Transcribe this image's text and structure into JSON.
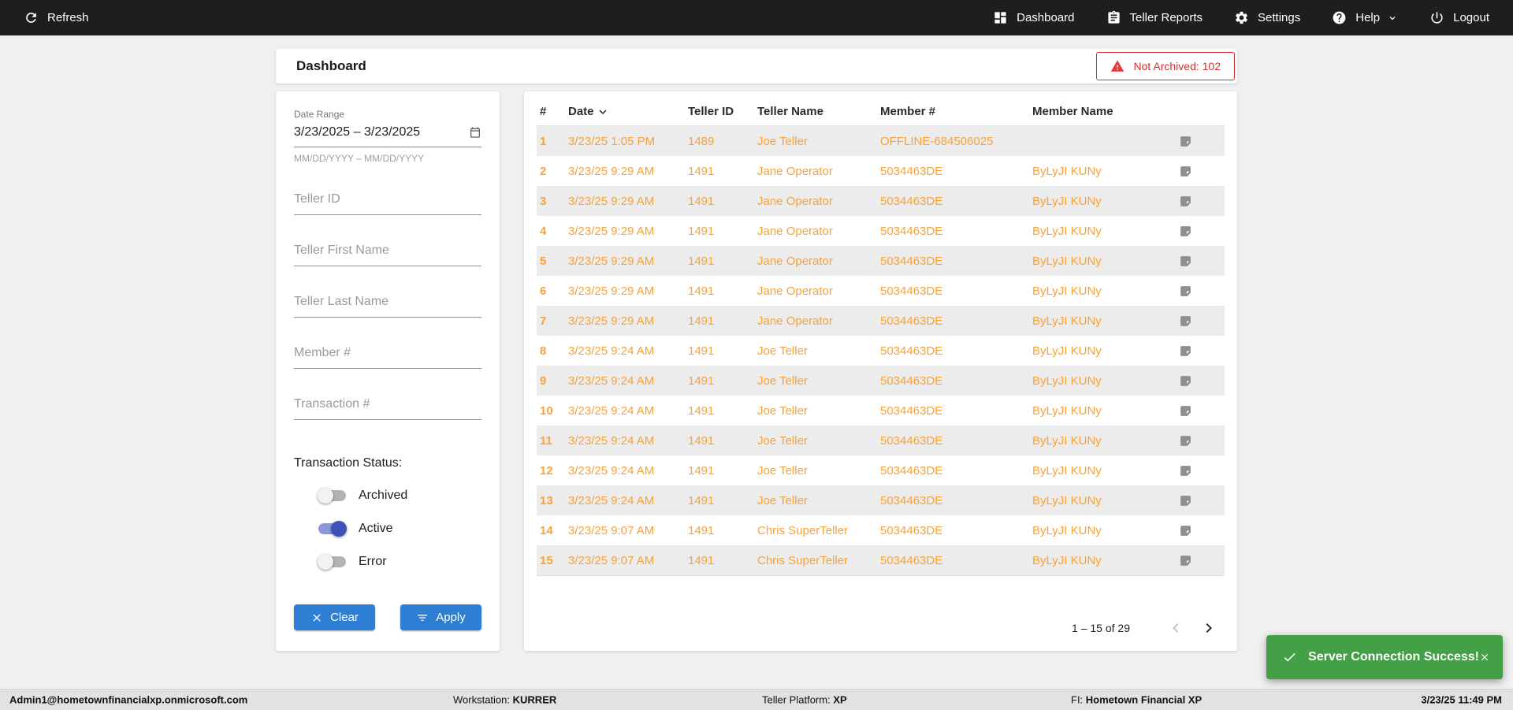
{
  "topbar": {
    "refresh": "Refresh",
    "dashboard": "Dashboard",
    "teller_reports": "Teller Reports",
    "settings": "Settings",
    "help": "Help",
    "logout": "Logout"
  },
  "header": {
    "title": "Dashboard",
    "not_archived_badge": "Not Archived: 102"
  },
  "filters": {
    "date_range_label": "Date Range",
    "date_range_value": "3/23/2025 – 3/23/2025",
    "date_range_hint": "MM/DD/YYYY – MM/DD/YYYY",
    "teller_id_placeholder": "Teller ID",
    "teller_first_name_placeholder": "Teller First Name",
    "teller_last_name_placeholder": "Teller Last Name",
    "member_number_placeholder": "Member #",
    "transaction_number_placeholder": "Transaction #",
    "transaction_status_label": "Transaction Status:",
    "toggles": [
      {
        "label": "Archived",
        "on": false
      },
      {
        "label": "Active",
        "on": true
      },
      {
        "label": "Error",
        "on": false
      }
    ],
    "clear_button": "Clear",
    "apply_button": "Apply"
  },
  "table": {
    "columns": [
      "#",
      "Date",
      "Teller ID",
      "Teller Name",
      "Member #",
      "Member Name"
    ],
    "sort": {
      "column": "Date",
      "direction": "desc"
    },
    "rows": [
      {
        "num": "1",
        "date": "3/23/25 1:05 PM",
        "teller_id": "1489",
        "teller_name": "Joe Teller",
        "member_number": "OFFLINE-684506025",
        "member_name": ""
      },
      {
        "num": "2",
        "date": "3/23/25 9:29 AM",
        "teller_id": "1491",
        "teller_name": "Jane Operator",
        "member_number": "5034463DE",
        "member_name": "ByLyJI KUNy"
      },
      {
        "num": "3",
        "date": "3/23/25 9:29 AM",
        "teller_id": "1491",
        "teller_name": "Jane Operator",
        "member_number": "5034463DE",
        "member_name": "ByLyJI KUNy"
      },
      {
        "num": "4",
        "date": "3/23/25 9:29 AM",
        "teller_id": "1491",
        "teller_name": "Jane Operator",
        "member_number": "5034463DE",
        "member_name": "ByLyJI KUNy"
      },
      {
        "num": "5",
        "date": "3/23/25 9:29 AM",
        "teller_id": "1491",
        "teller_name": "Jane Operator",
        "member_number": "5034463DE",
        "member_name": "ByLyJI KUNy"
      },
      {
        "num": "6",
        "date": "3/23/25 9:29 AM",
        "teller_id": "1491",
        "teller_name": "Jane Operator",
        "member_number": "5034463DE",
        "member_name": "ByLyJI KUNy"
      },
      {
        "num": "7",
        "date": "3/23/25 9:29 AM",
        "teller_id": "1491",
        "teller_name": "Jane Operator",
        "member_number": "5034463DE",
        "member_name": "ByLyJI KUNy"
      },
      {
        "num": "8",
        "date": "3/23/25 9:24 AM",
        "teller_id": "1491",
        "teller_name": "Joe Teller",
        "member_number": "5034463DE",
        "member_name": "ByLyJI KUNy"
      },
      {
        "num": "9",
        "date": "3/23/25 9:24 AM",
        "teller_id": "1491",
        "teller_name": "Joe Teller",
        "member_number": "5034463DE",
        "member_name": "ByLyJI KUNy"
      },
      {
        "num": "10",
        "date": "3/23/25 9:24 AM",
        "teller_id": "1491",
        "teller_name": "Joe Teller",
        "member_number": "5034463DE",
        "member_name": "ByLyJI KUNy"
      },
      {
        "num": "11",
        "date": "3/23/25 9:24 AM",
        "teller_id": "1491",
        "teller_name": "Joe Teller",
        "member_number": "5034463DE",
        "member_name": "ByLyJI KUNy"
      },
      {
        "num": "12",
        "date": "3/23/25 9:24 AM",
        "teller_id": "1491",
        "teller_name": "Joe Teller",
        "member_number": "5034463DE",
        "member_name": "ByLyJI KUNy"
      },
      {
        "num": "13",
        "date": "3/23/25 9:24 AM",
        "teller_id": "1491",
        "teller_name": "Joe Teller",
        "member_number": "5034463DE",
        "member_name": "ByLyJI KUNy"
      },
      {
        "num": "14",
        "date": "3/23/25 9:07 AM",
        "teller_id": "1491",
        "teller_name": "Chris SuperTeller",
        "member_number": "5034463DE",
        "member_name": "ByLyJI KUNy"
      },
      {
        "num": "15",
        "date": "3/23/25 9:07 AM",
        "teller_id": "1491",
        "teller_name": "Chris SuperTeller",
        "member_number": "5034463DE",
        "member_name": "ByLyJI KUNy"
      }
    ],
    "pagination": {
      "label": "1 – 15 of 29"
    }
  },
  "toast": {
    "message": "Server Connection Success!"
  },
  "statusbar": {
    "user": "Admin1@hometownfinancialxp.onmicrosoft.com",
    "workstation_label": "Workstation:",
    "workstation_value": "KURRER",
    "platform_label": "Teller Platform:",
    "platform_value": "XP",
    "fi_label": "FI:",
    "fi_value": "Hometown Financial XP",
    "datetime": "3/23/25 11:49 PM"
  },
  "colors": {
    "topbar_bg": "#1E1E1E",
    "accent_orange": "#F7A23B",
    "primary_blue": "#2E7FD4",
    "toggle_blue": "#3F51B5",
    "alert_red": "#D32F2F",
    "success_green": "#43A047"
  }
}
